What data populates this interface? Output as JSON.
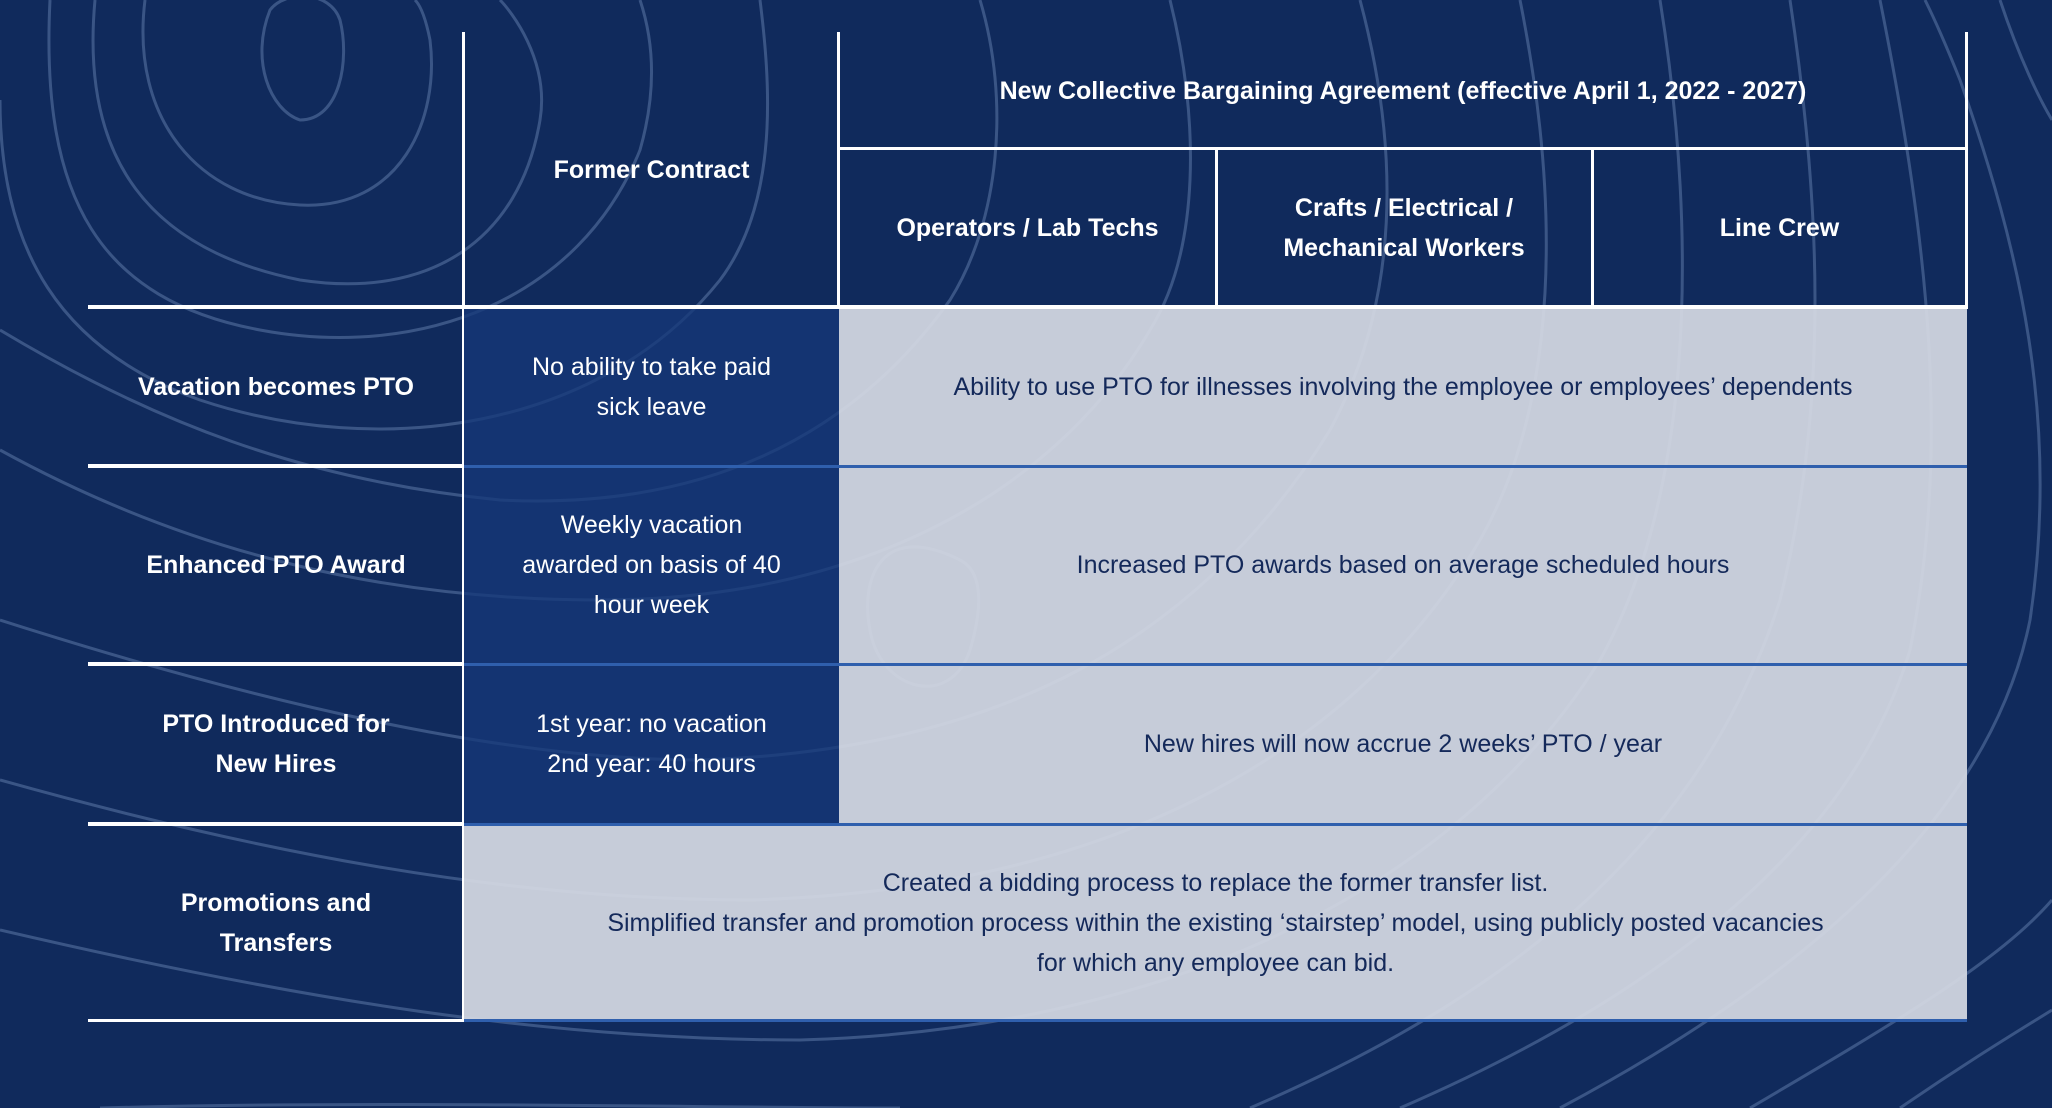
{
  "colors": {
    "background": "#102a5c",
    "former_cell": "#14326e",
    "light_cell": "#c9cedb",
    "light_text": "#14295a",
    "header_text": "#ffffff",
    "grid_white": "#ffffff",
    "grid_blue": "#2f5fad"
  },
  "header": {
    "former_contract": "Former Contract",
    "new_agreement": "New Collective Bargaining Agreement (effective April 1, 2022 - 2027)",
    "groups": [
      {
        "lines": [
          "Operators / Lab Techs"
        ]
      },
      {
        "lines": [
          "Crafts / Electrical /",
          "Mechanical Workers"
        ]
      },
      {
        "lines": [
          "Line Crew"
        ]
      }
    ]
  },
  "rows": [
    {
      "label": [
        "Vacation becomes PTO"
      ],
      "former": [
        "No ability to take paid",
        "sick leave"
      ],
      "new": [
        "Ability to use PTO for illnesses involving the employee or employees’ dependents"
      ]
    },
    {
      "label": [
        "Enhanced PTO Award"
      ],
      "former": [
        "Weekly vacation",
        "awarded on basis of 40",
        "hour week"
      ],
      "new": [
        "Increased PTO awards based on average scheduled hours"
      ]
    },
    {
      "label": [
        "PTO Introduced for",
        "New Hires"
      ],
      "former": [
        "1st year: no vacation",
        "2nd year: 40 hours"
      ],
      "new": [
        "New hires will now accrue 2 weeks’ PTO / year"
      ]
    },
    {
      "label": [
        "Promotions and",
        "Transfers"
      ],
      "combined": [
        "Created a bidding process to replace the former transfer list.",
        "Simplified transfer and promotion process within the existing ‘stairstep’ model, using publicly posted vacancies",
        "for which any employee can bid."
      ]
    }
  ]
}
